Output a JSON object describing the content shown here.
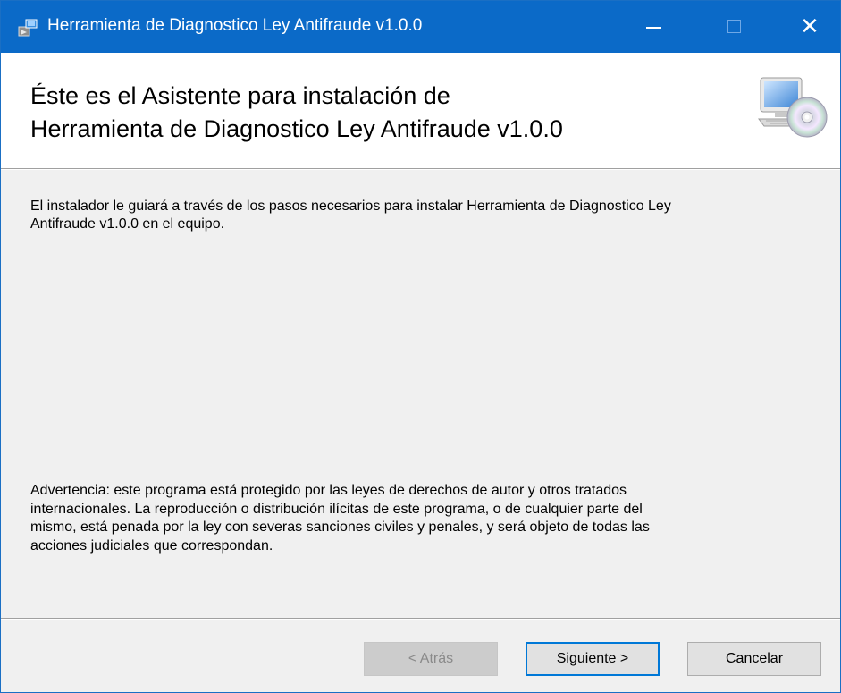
{
  "window": {
    "title": "Herramienta de Diagnostico Ley Antifraude v1.0.0",
    "title_icon": "installer-icon",
    "controls": {
      "minimize": "—",
      "maximize": "□",
      "close": "✕"
    }
  },
  "header": {
    "title_line1": "Éste es el Asistente para instalación de",
    "title_line2": "Herramienta de Diagnostico Ley Antifraude v1.0.0",
    "icon": "computer-cd-icon"
  },
  "body": {
    "intro_line1": "El instalador le guiará a través de los pasos necesarios para instalar Herramienta de Diagnostico Ley",
    "intro_line2": "Antifraude v1.0.0 en el equipo.",
    "warning_line1": "Advertencia: este programa está protegido por las leyes de derechos de autor y otros tratados",
    "warning_line2": "internacionales. La reproducción o distribución ilícitas de este programa, o de cualquier parte del",
    "warning_line3": "mismo, está penada por la ley con severas sanciones civiles y penales, y será objeto de todas las",
    "warning_line4": "acciones judiciales que correspondan."
  },
  "buttons": {
    "back": "< Atrás",
    "next": "Siguiente >",
    "cancel": "Cancelar"
  },
  "colors": {
    "titlebar": "#0b6ac8",
    "focus_border": "#0078d7",
    "dialog_bg": "#f0f0f0"
  }
}
